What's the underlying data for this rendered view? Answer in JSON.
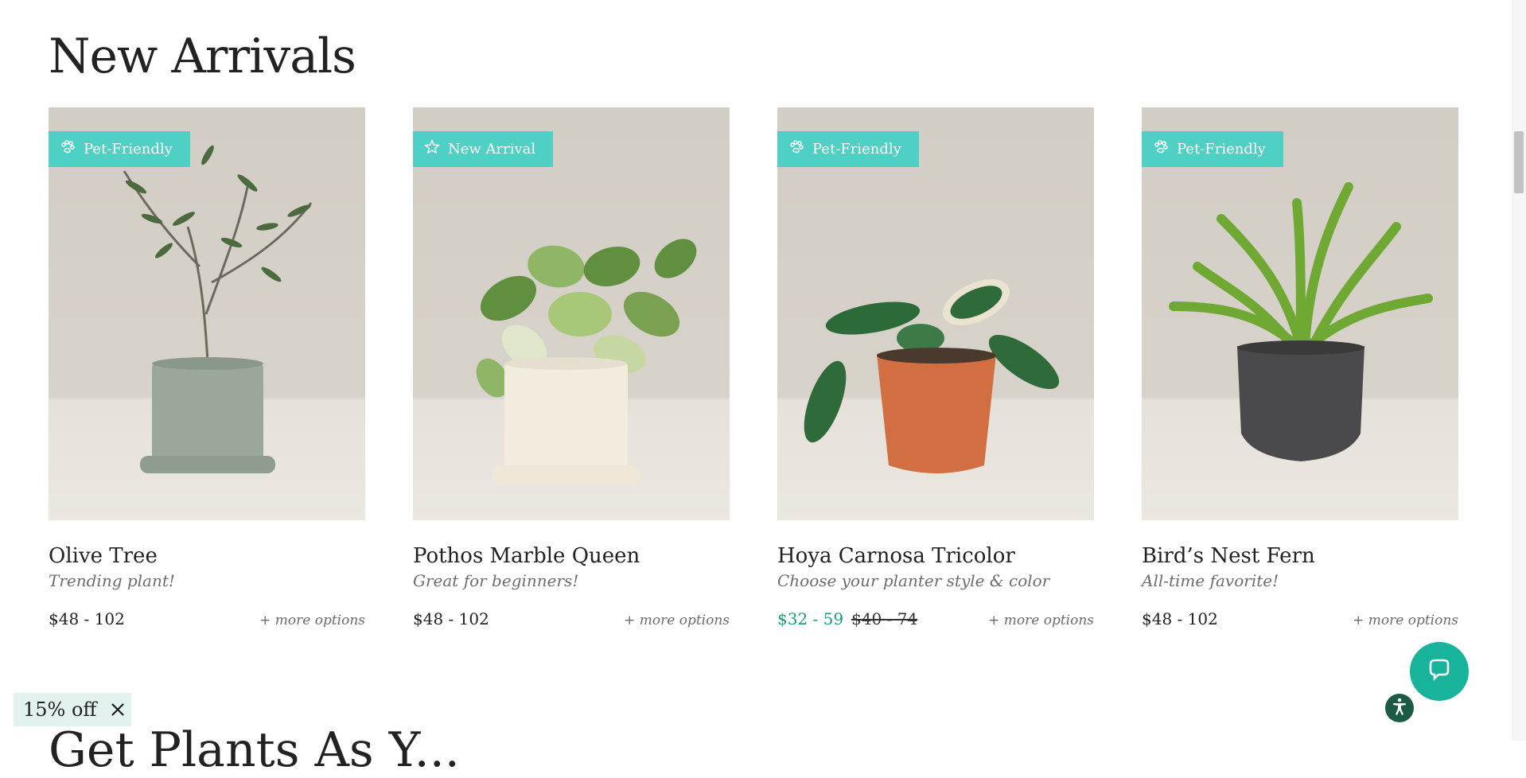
{
  "section": {
    "title": "New Arrivals"
  },
  "next_section": {
    "title": "Get Plants As Y..."
  },
  "products": [
    {
      "badge": "Pet-Friendly",
      "badge_icon": "paw-icon",
      "name": "Olive Tree",
      "tagline": "Trending plant!",
      "price": "$48 - 102",
      "more": "+ more options"
    },
    {
      "badge": "New Arrival",
      "badge_icon": "star-icon",
      "name": "Pothos Marble Queen",
      "tagline": "Great for beginners!",
      "price": "$48 - 102",
      "more": "+ more options"
    },
    {
      "badge": "Pet-Friendly",
      "badge_icon": "paw-icon",
      "name": "Hoya Carnosa Tricolor",
      "tagline": "Choose your planter style & color",
      "sale_price": "$32 - 59",
      "original_price": "$40 - 74",
      "more": "+ more options"
    },
    {
      "badge": "Pet-Friendly",
      "badge_icon": "paw-icon",
      "name": "Bird’s Nest Fern",
      "tagline": "All-time favorite!",
      "price": "$48 - 102",
      "more": "+ more options"
    }
  ],
  "promo": {
    "label": "15% off",
    "icon": "close-icon"
  },
  "widgets": {
    "chat_icon": "chat-bubble-icon",
    "accessibility_icon": "accessibility-icon"
  },
  "colors": {
    "badge": "#4ed1c4",
    "sale": "#1a9b7d",
    "chat": "#17b39a",
    "promo_bg": "#e2f2ee"
  }
}
